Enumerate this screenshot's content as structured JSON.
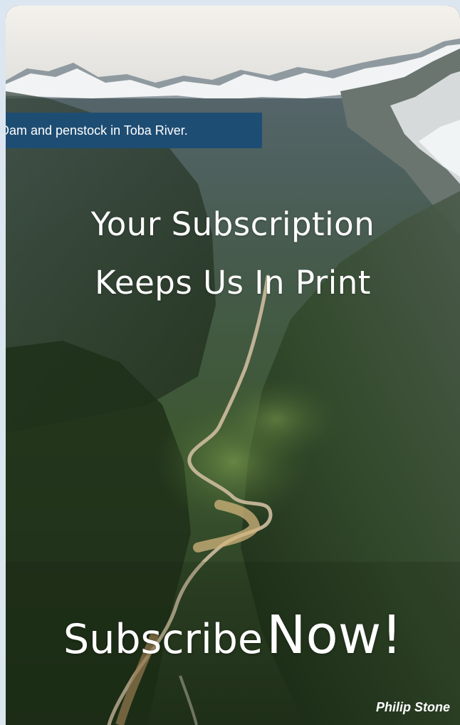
{
  "caption": "Dam and penstock in Toba River.",
  "headline": {
    "line1": "Your Subscription",
    "line2": "Keeps Us In Print"
  },
  "cta": {
    "part1": "Subscribe",
    "part2": "Now!"
  },
  "credit": "Philip Stone",
  "colors": {
    "caption_bg": "#1e4d73",
    "page_bg": "#dce6f0",
    "text": "#ffffff"
  }
}
